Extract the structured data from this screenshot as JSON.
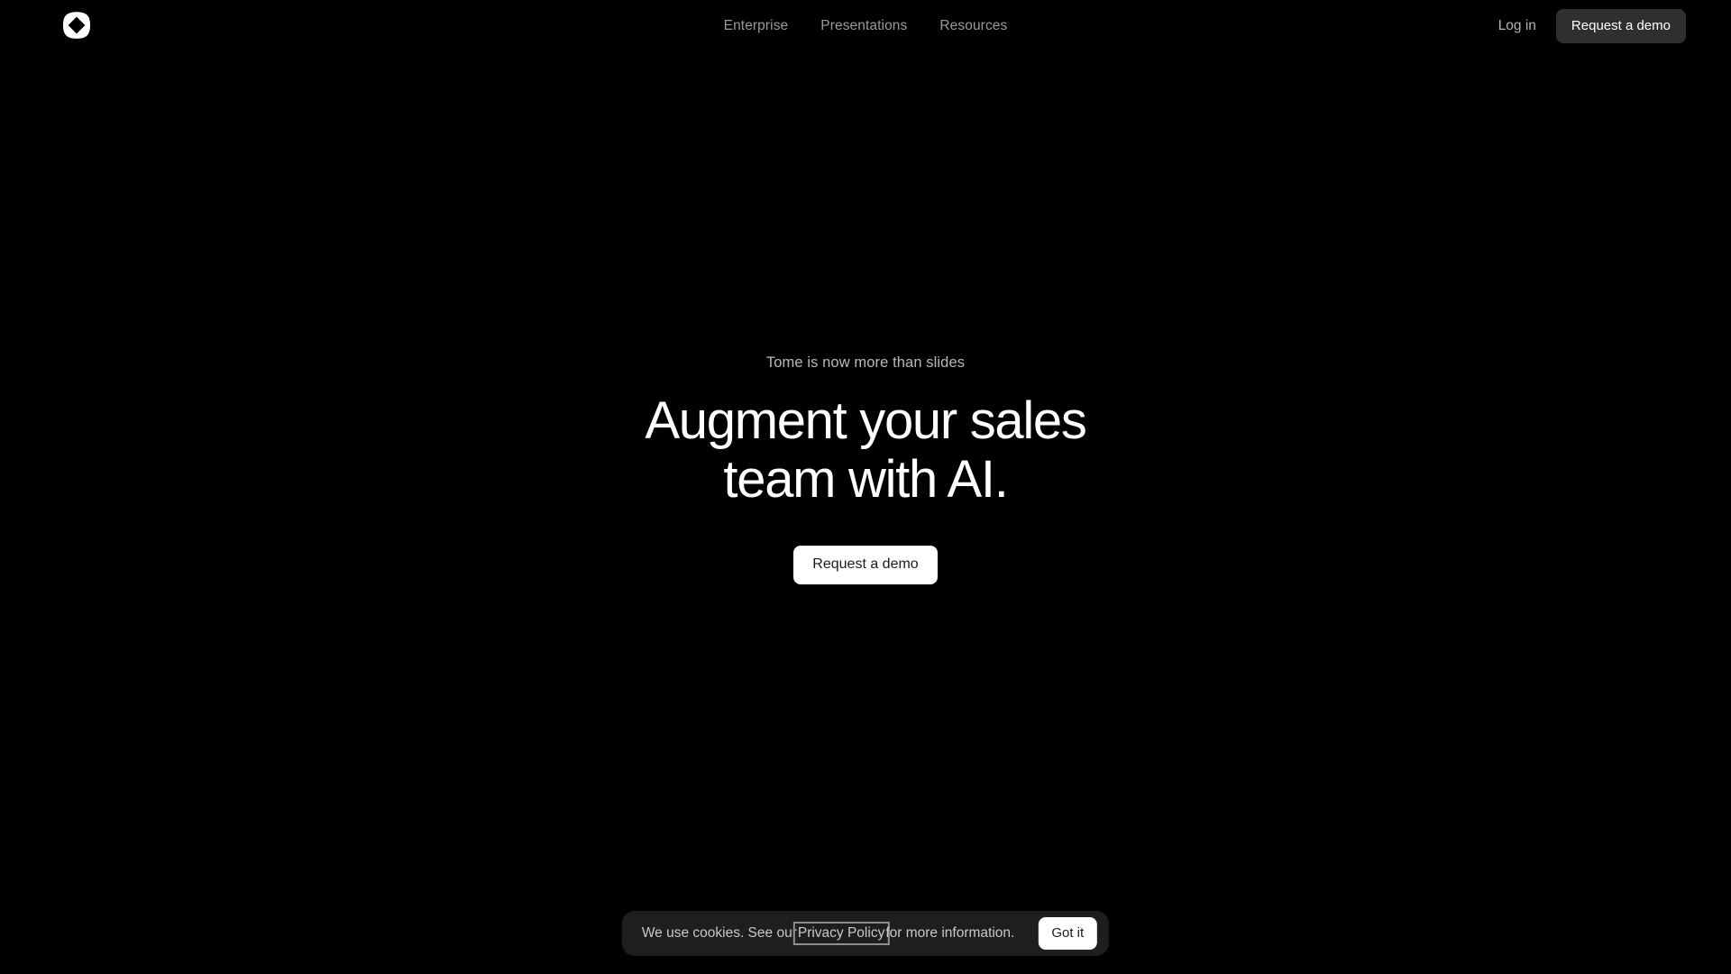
{
  "site": {
    "background_color": "#000000",
    "brand_name": "Tome",
    "logo_icon": "tome-octagon-diamond-logo"
  },
  "header": {
    "nav_links": [
      {
        "label": "Enterprise"
      },
      {
        "label": "Presentations"
      },
      {
        "label": "Resources"
      }
    ],
    "login_label": "Log in",
    "cta_label": "Request a demo",
    "cta_bg_color": "#2f2f2f",
    "link_color": "#9a9a9a"
  },
  "hero": {
    "eyebrow": "Tome is now more than slides",
    "title_line_1": "Augment your sales",
    "title_line_2": "team with AI.",
    "cta_label": "Request a demo",
    "cta_bg_color": "#ffffff",
    "title_color": "#ffffff"
  },
  "cookie_banner": {
    "text_before": "We use cookies. See our",
    "link_label": "Privacy Policy",
    "text_after": "for more information.",
    "accept_label": "Got it",
    "bg_color": "#1e1e1e",
    "focus_ring_color": "#8e8e8e"
  }
}
